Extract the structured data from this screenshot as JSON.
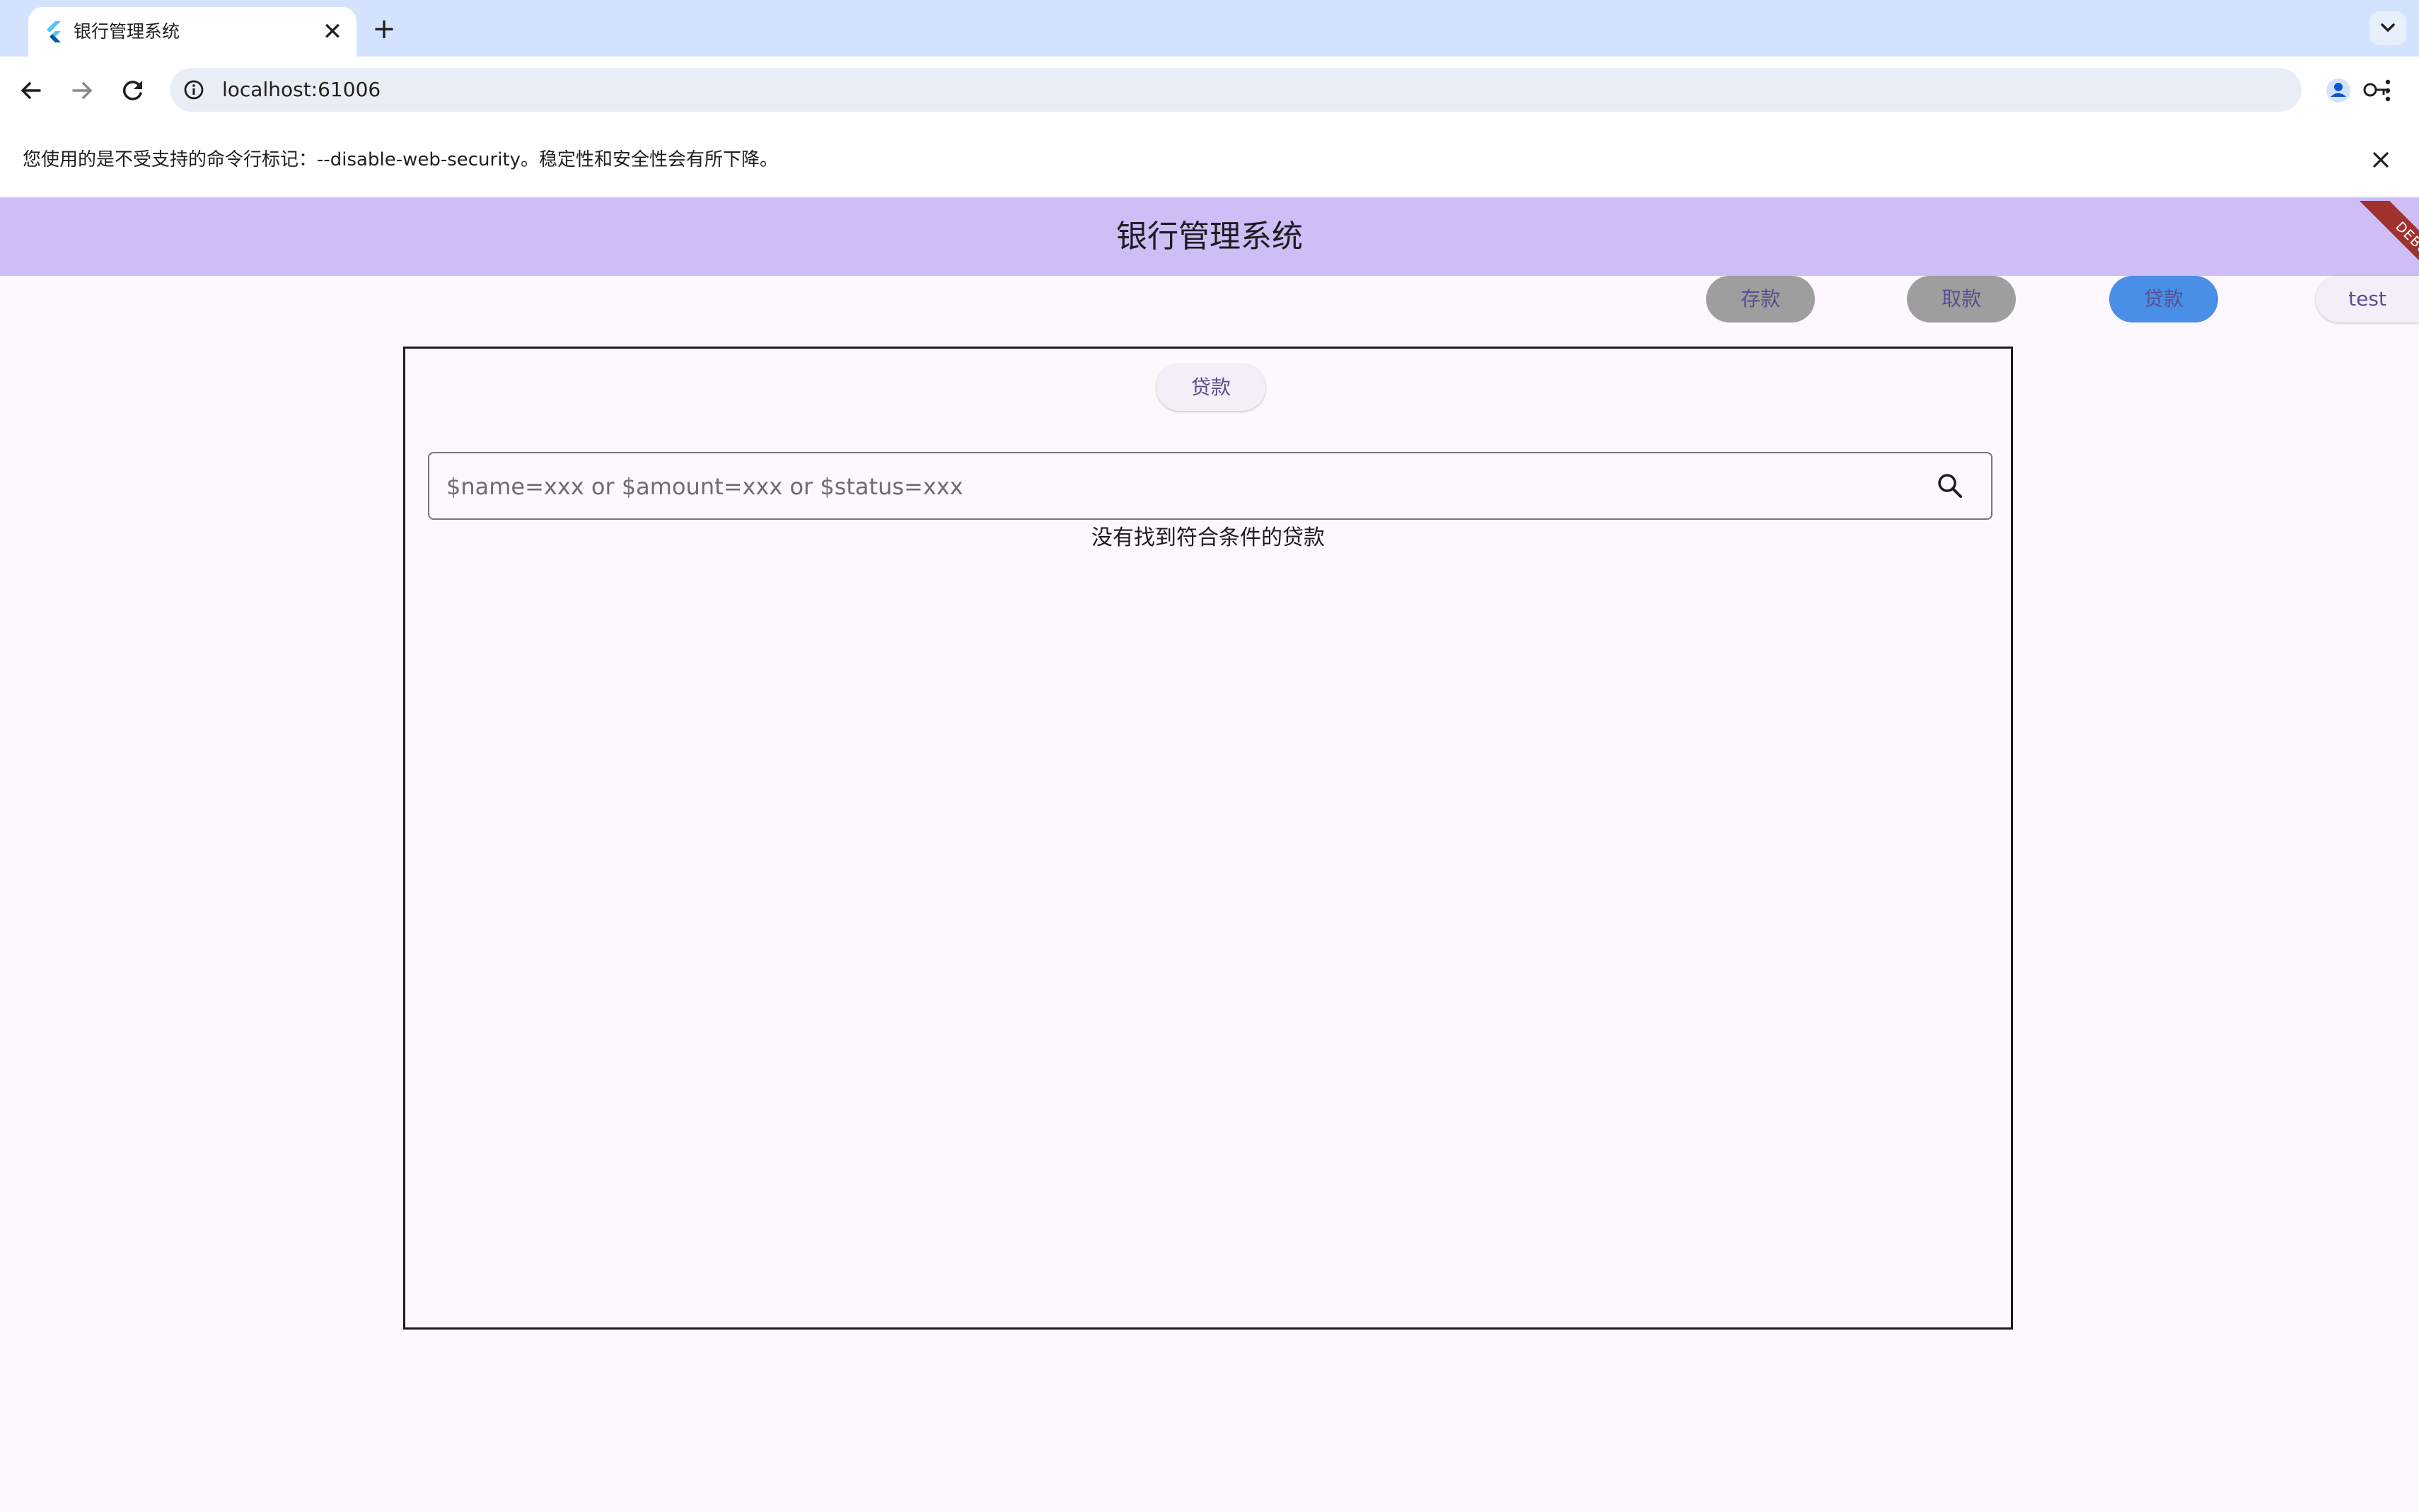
{
  "browser": {
    "tab_title": "银行管理系统",
    "tab_close": "✕",
    "new_tab": "+",
    "url": "localhost:61006",
    "icons": [
      "back-icon",
      "forward-icon",
      "reload-icon",
      "info-icon",
      "key-icon",
      "star-icon",
      "profile-icon",
      "menu-icon"
    ]
  },
  "infobar": {
    "message": "您使用的是不受支持的命令行标记：--disable-web-security。稳定性和安全性会有所下降。"
  },
  "app": {
    "title": "银行管理系统",
    "debug_label": "DEBUG",
    "nav": {
      "deposit": "存款",
      "withdraw": "取款",
      "loan": "贷款",
      "user": "test"
    },
    "panel": {
      "button_label": "贷款",
      "search_placeholder": "$name=xxx or $amount=xxx or $status=xxx",
      "search_value": "",
      "empty_message": "没有找到符合条件的贷款"
    },
    "colors": {
      "appbar": "#cfbdf6",
      "nav_inactive": "#9e9e9e",
      "nav_active": "#4a8fe7",
      "background": "#fdf7fe",
      "debug": "#a0322f"
    }
  }
}
